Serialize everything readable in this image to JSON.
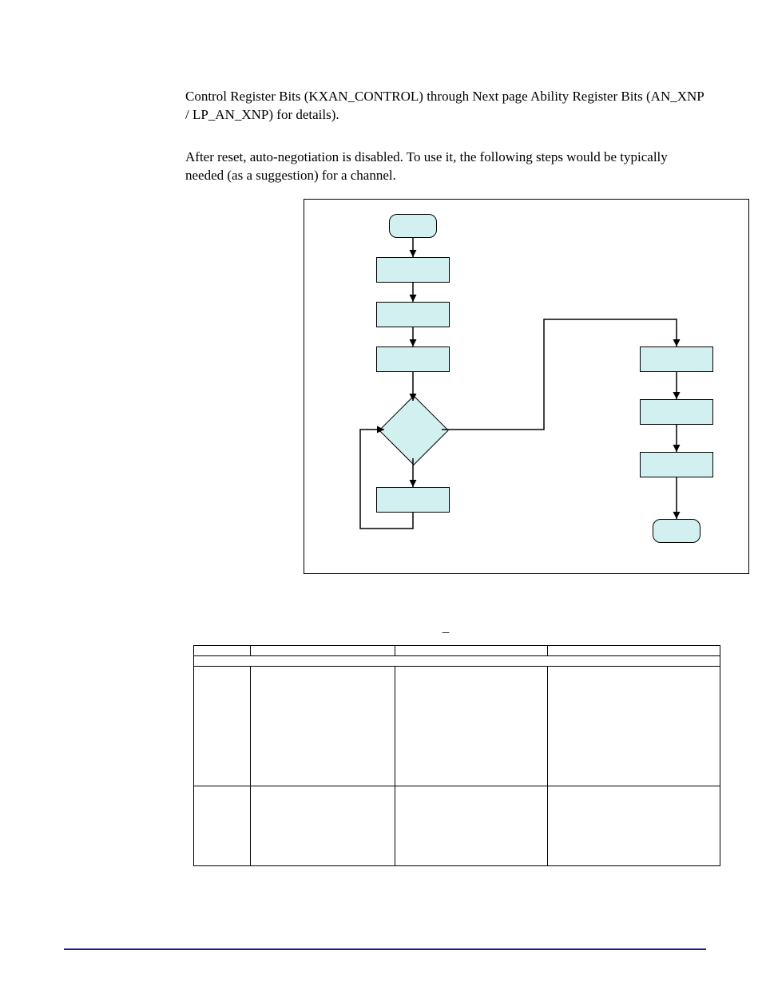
{
  "para1": "Control Register Bits (KXAN_CONTROL) through Next page Ability Register Bits (AN_XNP / LP_AN_XNP) for details).",
  "para2": "After reset, auto-negotiation is disabled. To use it, the following steps would be typically needed (as a suggestion) for a channel.",
  "table_title": "_",
  "headers": {
    "bit": "",
    "name": "",
    "def": "",
    "desc": ""
  },
  "rows": [
    {
      "bit": "",
      "name": "",
      "def": "",
      "desc": ""
    },
    {
      "bit": "",
      "name": "",
      "def": "",
      "desc": ""
    }
  ],
  "chart_data": {
    "type": "flowchart",
    "nodes": [
      {
        "id": "start",
        "shape": "rounded",
        "label": ""
      },
      {
        "id": "step1",
        "shape": "rect",
        "label": ""
      },
      {
        "id": "step2",
        "shape": "rect",
        "label": ""
      },
      {
        "id": "step3",
        "shape": "rect",
        "label": ""
      },
      {
        "id": "decision",
        "shape": "diamond",
        "label": ""
      },
      {
        "id": "wait",
        "shape": "rect",
        "label": ""
      },
      {
        "id": "r1",
        "shape": "rect",
        "label": ""
      },
      {
        "id": "r2",
        "shape": "rect",
        "label": ""
      },
      {
        "id": "r3",
        "shape": "rect",
        "label": ""
      },
      {
        "id": "end",
        "shape": "rounded",
        "label": ""
      }
    ],
    "edges": [
      [
        "start",
        "step1"
      ],
      [
        "step1",
        "step2"
      ],
      [
        "step2",
        "step3"
      ],
      [
        "step3",
        "decision"
      ],
      [
        "decision",
        "wait"
      ],
      [
        "wait",
        "decision"
      ],
      [
        "decision",
        "r1"
      ],
      [
        "r1",
        "r2"
      ],
      [
        "r2",
        "r3"
      ],
      [
        "r3",
        "end"
      ]
    ]
  }
}
